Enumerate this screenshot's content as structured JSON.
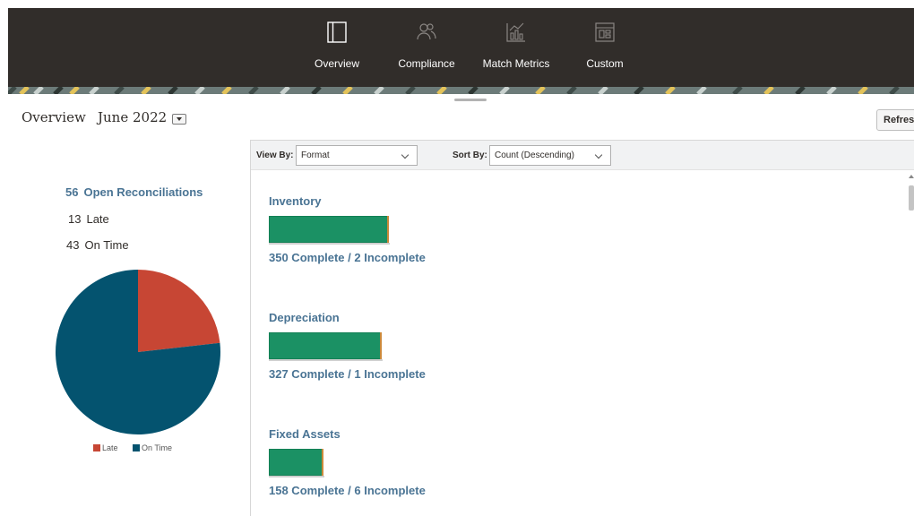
{
  "nav": {
    "items": [
      {
        "label": "Overview",
        "icon": "panel-icon"
      },
      {
        "label": "Compliance",
        "icon": "users-icon"
      },
      {
        "label": "Match Metrics",
        "icon": "chart-icon"
      },
      {
        "label": "Custom",
        "icon": "dashboard-icon"
      }
    ]
  },
  "header": {
    "title": "Overview",
    "period": "June 2022",
    "refresh_label": "Refresh"
  },
  "summary": {
    "open_count": "56",
    "open_label": "Open Reconciliations",
    "late_count": "13",
    "late_label": "Late",
    "ontime_count": "43",
    "ontime_label": "On Time"
  },
  "chart_data": {
    "type": "pie",
    "labels": [
      "Late",
      "On Time"
    ],
    "values": [
      13,
      43
    ],
    "colors": [
      "#c74634",
      "#04536f"
    ],
    "legend": "bottom"
  },
  "toolbar": {
    "view_by_label": "View By:",
    "view_by_value": "Format",
    "sort_by_label": "Sort By:",
    "sort_by_value": "Count (Descending)"
  },
  "groups": [
    {
      "title": "Inventory",
      "complete": 350,
      "incomplete": 2,
      "caption": "350 Complete / 2 Incomplete"
    },
    {
      "title": "Depreciation",
      "complete": 327,
      "incomplete": 1,
      "caption": "327 Complete / 1 Incomplete"
    },
    {
      "title": "Fixed Assets",
      "complete": 158,
      "incomplete": 6,
      "caption": "158 Complete / 6 Incomplete"
    }
  ],
  "colors": {
    "nav_bg": "#312d2a",
    "link": "#4a7494",
    "complete": "#1b9164",
    "incomplete": "#c9893a",
    "late": "#c74634",
    "on_time": "#04536f"
  }
}
